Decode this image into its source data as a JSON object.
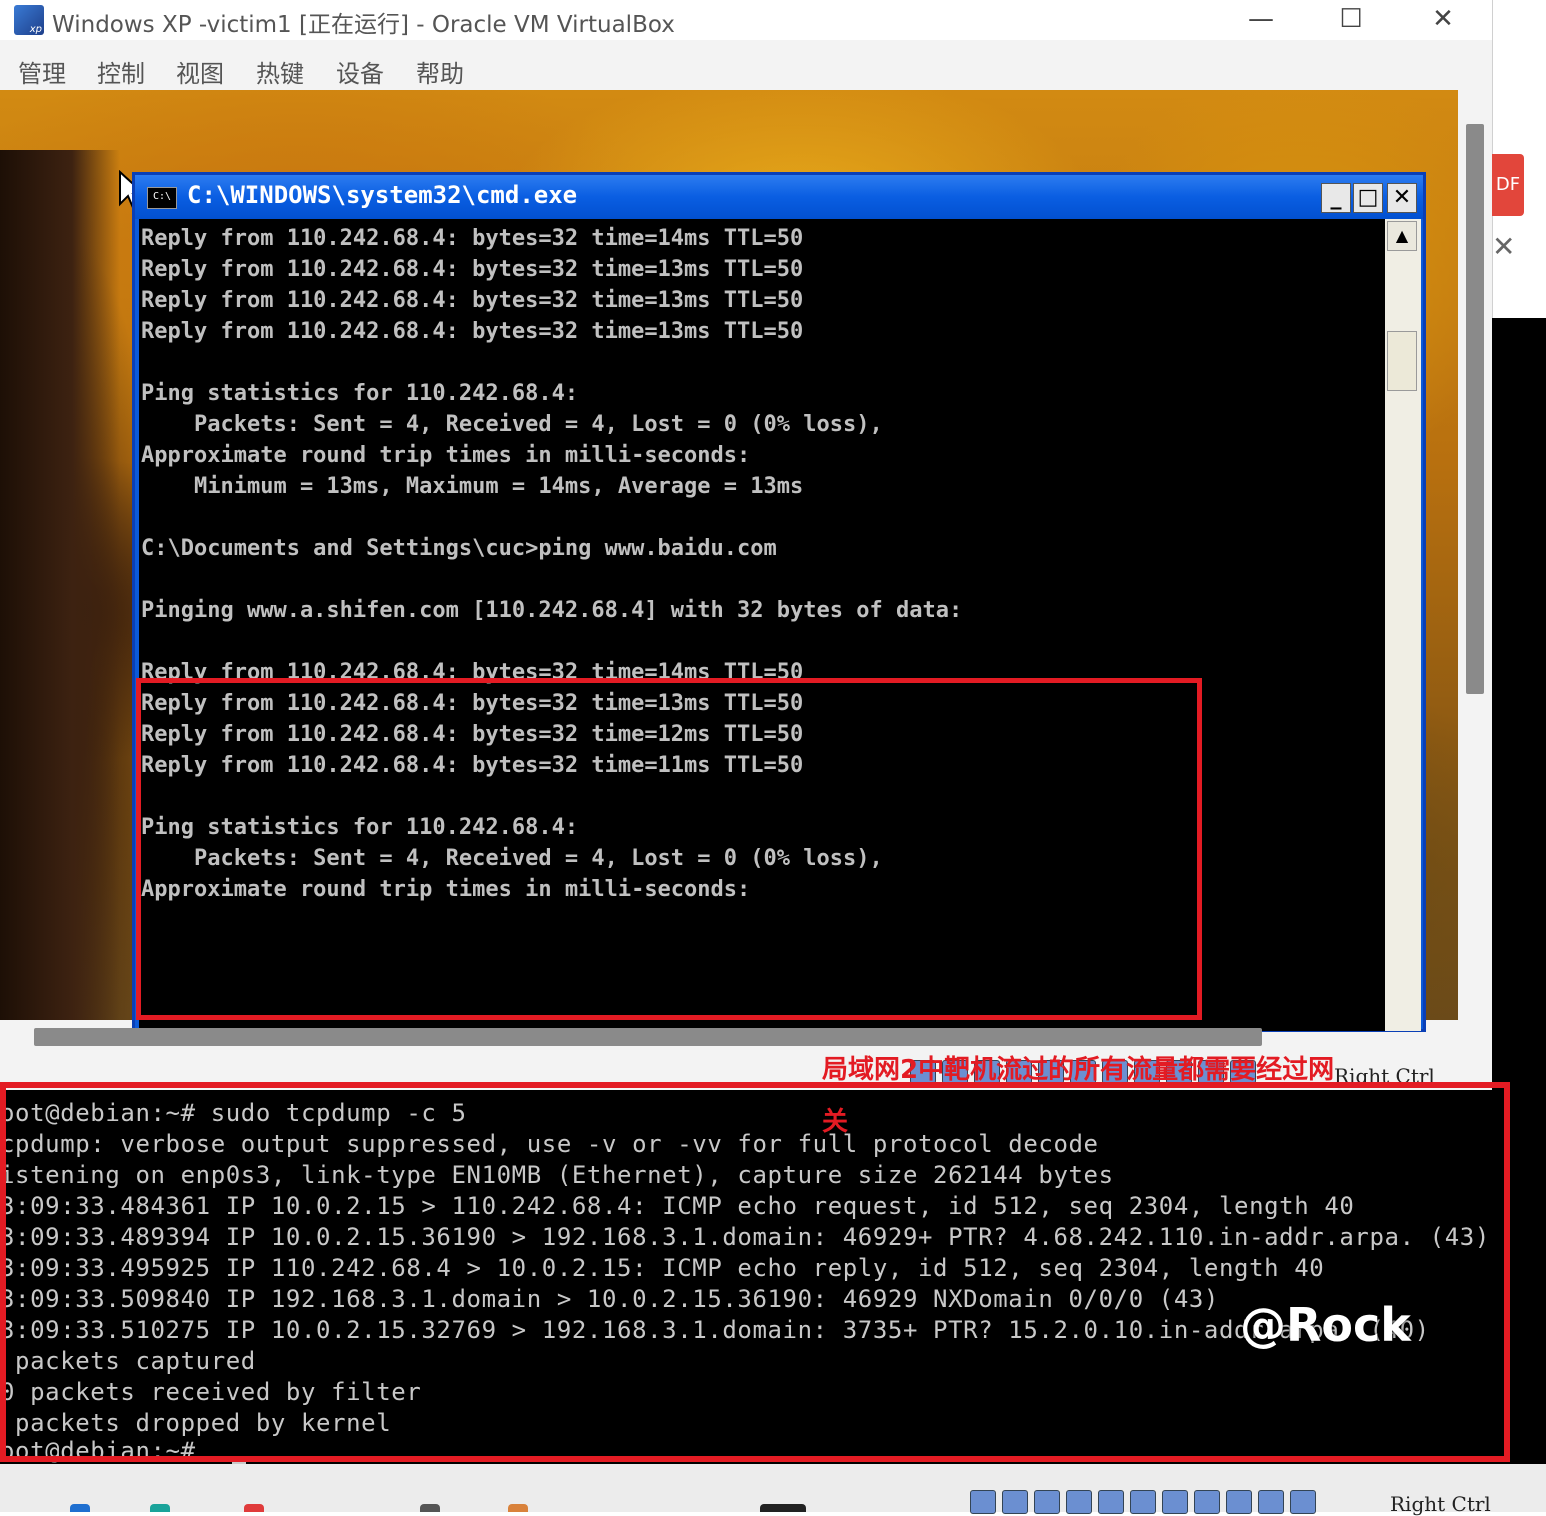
{
  "vbox": {
    "title": "Windows XP -victim1 [正在运行] - Oracle VM VirtualBox",
    "icon_text": "xp",
    "controls": {
      "minimize": "—",
      "maximize": "☐",
      "close": "✕"
    },
    "menu": [
      "管理",
      "控制",
      "视图",
      "热键",
      "设备",
      "帮助"
    ],
    "host_key": "Right Ctrl"
  },
  "cmd": {
    "icon_text": "C:\\",
    "title": "C:\\WINDOWS\\system32\\cmd.exe",
    "buttons": {
      "minimize": "_",
      "maximize": "□",
      "close": "✕"
    },
    "lines": [
      "Reply from 110.242.68.4: bytes=32 time=14ms TTL=50",
      "Reply from 110.242.68.4: bytes=32 time=13ms TTL=50",
      "Reply from 110.242.68.4: bytes=32 time=13ms TTL=50",
      "Reply from 110.242.68.4: bytes=32 time=13ms TTL=50",
      "",
      "Ping statistics for 110.242.68.4:",
      "    Packets: Sent = 4, Received = 4, Lost = 0 (0% loss),",
      "Approximate round trip times in milli-seconds:",
      "    Minimum = 13ms, Maximum = 14ms, Average = 13ms",
      "",
      "C:\\Documents and Settings\\cuc>ping www.baidu.com",
      "",
      "Pinging www.a.shifen.com [110.242.68.4] with 32 bytes of data:",
      "",
      "Reply from 110.242.68.4: bytes=32 time=14ms TTL=50",
      "Reply from 110.242.68.4: bytes=32 time=13ms TTL=50",
      "Reply from 110.242.68.4: bytes=32 time=12ms TTL=50",
      "Reply from 110.242.68.4: bytes=32 time=11ms TTL=50",
      "",
      "Ping statistics for 110.242.68.4:",
      "    Packets: Sent = 4, Received = 4, Lost = 0 (0% loss),",
      "Approximate round trip times in milli-seconds:"
    ]
  },
  "terminal": {
    "lines": [
      "oot@debian:~# sudo tcpdump -c 5",
      "cpdump: verbose output suppressed, use -v or -vv for full protocol decode",
      "istening on enp0s3, link-type EN10MB (Ethernet), capture size 262144 bytes",
      "3:09:33.484361 IP 10.0.2.15 > 110.242.68.4: ICMP echo request, id 512, seq 2304, length 40",
      "3:09:33.489394 IP 10.0.2.15.36190 > 192.168.3.1.domain: 46929+ PTR? 4.68.242.110.in-addr.arpa. (43)",
      "3:09:33.495925 IP 110.242.68.4 > 10.0.2.15: ICMP echo reply, id 512, seq 2304, length 40",
      "3:09:33.509840 IP 192.168.3.1.domain > 10.0.2.15.36190: 46929 NXDomain 0/0/0 (43)",
      "3:09:33.510275 IP 10.0.2.15.32769 > 192.168.3.1.domain: 3735+ PTR? 15.2.0.10.in-addr.arpa. (40)",
      " packets captured",
      "0 packets received by filter",
      " packets dropped by kernel",
      "oot@debian:~#"
    ]
  },
  "annotation": "局域网2中靶机流过的所有流量都需要经过网关",
  "watermark": "@Rock",
  "side": {
    "pdf_badge": "DF",
    "close": "✕"
  },
  "colors": {
    "highlight": "#e31b23",
    "xp_title_blue": "#0a5ee2"
  }
}
